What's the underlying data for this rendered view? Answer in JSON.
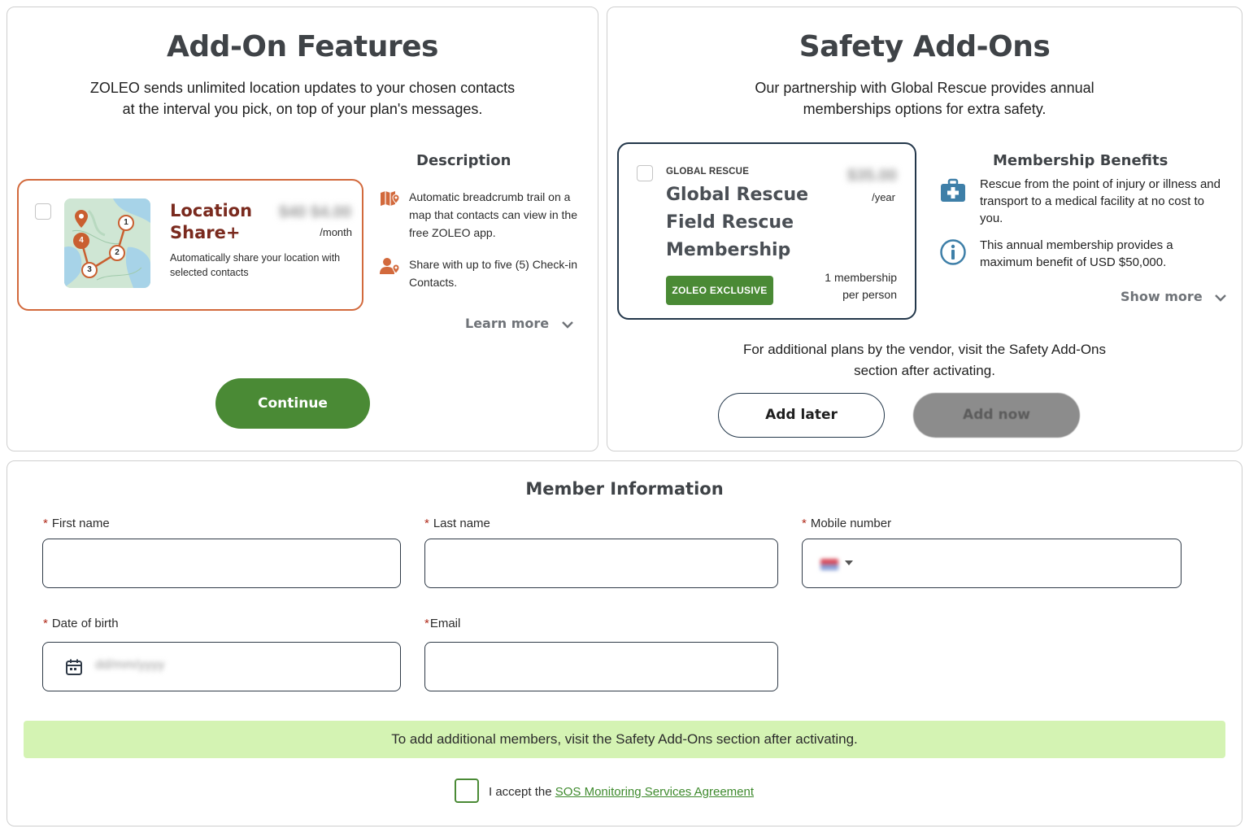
{
  "addon": {
    "title": "Add-On Features",
    "lead_line1": "ZOLEO sends unlimited location updates to your chosen contacts",
    "lead_line2": "at the interval you pick, on top of your plan's messages.",
    "card": {
      "title_line1": "Location",
      "title_line2": "Share+",
      "price": "$40 $4.00",
      "period": "/month",
      "description": "Automatically share your location with selected contacts",
      "map_markers": [
        "1",
        "2",
        "3",
        "4"
      ],
      "checked": false
    },
    "description_heading": "Description",
    "features": [
      {
        "icon": "map-pin-icon",
        "text": "Automatic breadcrumb trail on a map that contacts can view in the free ZOLEO app."
      },
      {
        "icon": "contact-location-icon",
        "text": "Share with up to five (5) Check-in Contacts."
      }
    ],
    "learn_more": "Learn more",
    "continue": "Continue",
    "accent": "#d2693c",
    "brand_green": "#4a8a35"
  },
  "safety": {
    "title": "Safety Add-Ons",
    "lead_line1": "Our partnership with Global Rescue provides annual",
    "lead_line2": "memberships options for extra safety.",
    "card": {
      "brand": "GLOBAL RESCUE",
      "title_line1": "Global Rescue",
      "title_line2": "Field Rescue",
      "title_line3": "Membership",
      "price": "$35.00",
      "period": "/year",
      "badge": "ZOLEO EXCLUSIVE",
      "count_line1": "1 membership",
      "count_line2": "per person",
      "checked": false
    },
    "benefits_heading": "Membership Benefits",
    "benefits": [
      {
        "icon": "first-aid-kit-icon",
        "text": "Rescue from the point of injury or illness and transport to a medical facility at no cost to you."
      },
      {
        "icon": "info-icon",
        "text": "This annual membership provides a maximum benefit of USD $50,000."
      }
    ],
    "show_more": "Show more",
    "additional_line1": "For additional plans by the vendor, visit the Safety Add-Ons",
    "additional_line2": "section after activating.",
    "add_later": "Add later",
    "add_now": "Add now"
  },
  "member": {
    "title": "Member Information",
    "required_mark": "*",
    "first_name_label": "First name",
    "last_name_label": "Last name",
    "mobile_label": "Mobile number",
    "dob_label": "Date of birth",
    "email_label": "Email",
    "dob_placeholder": "dd/mm/yyyy",
    "first_name_value": "",
    "last_name_value": "",
    "mobile_value": "",
    "email_value": "",
    "notice": "To add additional members, visit the Safety Add-Ons section after activating.",
    "agree_prefix": "I accept the",
    "agree_link": "SOS Monitoring Services Agreement",
    "agree_checked": false
  }
}
